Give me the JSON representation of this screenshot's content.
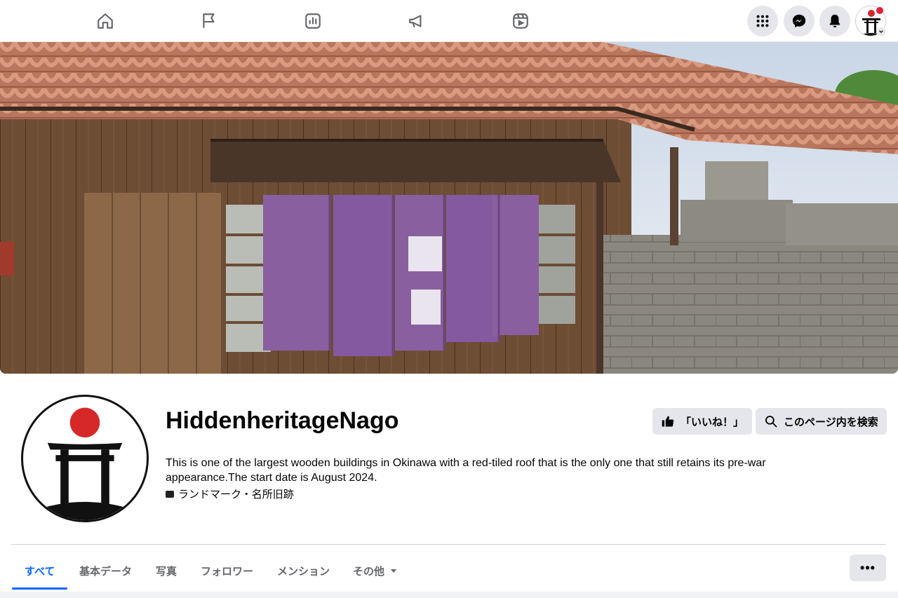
{
  "topnav": {
    "icons": [
      "home-icon",
      "flag-icon",
      "insights-icon",
      "megaphone-icon",
      "reels-icon"
    ],
    "right": [
      "menu-grid-icon",
      "messenger-icon",
      "notifications-icon",
      "profile-avatar"
    ]
  },
  "profile": {
    "name": "HiddenheritageNago",
    "description": "This is one of the largest wooden buildings in Okinawa with a red-tiled roof that is the only one that still retains its pre-war appearance.The start date is August 2024.",
    "category": "ランドマーク・名所旧跡"
  },
  "actions": {
    "like_label": "「いいね！」",
    "search_label": "このページ内を検索"
  },
  "tabs": [
    {
      "label": "すべて"
    },
    {
      "label": "基本データ"
    },
    {
      "label": "写真"
    },
    {
      "label": "フォロワー"
    },
    {
      "label": "メンション"
    },
    {
      "label": "その他"
    }
  ],
  "more_label": "•••",
  "colors": {
    "accent": "#0866ff",
    "button_bg": "#e4e6eb",
    "noren_purple": "#8a5fa0",
    "roof_red": "#c9745a",
    "sun_red": "#d62828"
  }
}
